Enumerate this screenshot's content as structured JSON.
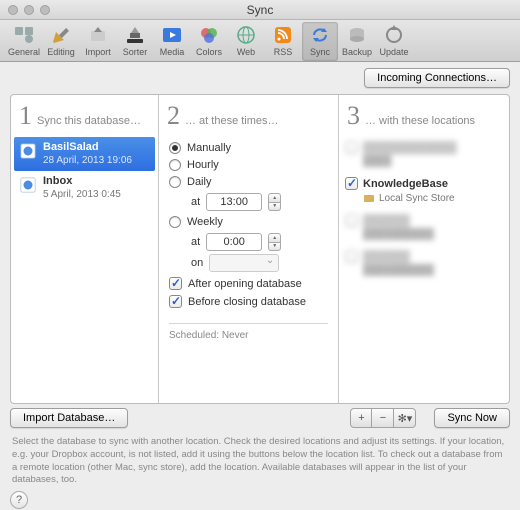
{
  "window": {
    "title": "Sync"
  },
  "toolbar": {
    "items": [
      {
        "label": "General"
      },
      {
        "label": "Editing"
      },
      {
        "label": "Import"
      },
      {
        "label": "Sorter"
      },
      {
        "label": "Media"
      },
      {
        "label": "Colors"
      },
      {
        "label": "Web"
      },
      {
        "label": "RSS"
      },
      {
        "label": "Sync"
      },
      {
        "label": "Backup"
      },
      {
        "label": "Update"
      }
    ]
  },
  "incoming_btn": "Incoming Connections…",
  "step1": {
    "num": "1",
    "label": "Sync this database…",
    "databases": [
      {
        "name": "BasilSalad",
        "date": "28 April, 2013 19:06",
        "selected": true
      },
      {
        "name": "Inbox",
        "date": "5 April, 2013 0:45",
        "selected": false
      }
    ],
    "import_btn": "Import Database…"
  },
  "step2": {
    "num": "2",
    "label": "… at these times…",
    "manually": "Manually",
    "hourly": "Hourly",
    "daily": "Daily",
    "weekly": "Weekly",
    "at": "at",
    "on": "on",
    "time_daily": "13:00",
    "time_weekly": "0:00",
    "after": "After opening database",
    "before": "Before closing database",
    "scheduled_label": "Scheduled:",
    "scheduled_value": "Never"
  },
  "step3": {
    "num": "3",
    "label": "… with these locations",
    "kb_label": "KnowledgeBase",
    "kb_sub": "Local Sync Store"
  },
  "bottom": {
    "sync_now": "Sync Now"
  },
  "help_text": "Select the database to sync with another location. Check the desired locations and adjust its settings. If your location, e.g. your Dropbox account, is not listed, add it using the buttons below the location list. To check out a database from a remote location (other Mac, sync store), add the location. Available databases will appear in the list of your databases, too."
}
